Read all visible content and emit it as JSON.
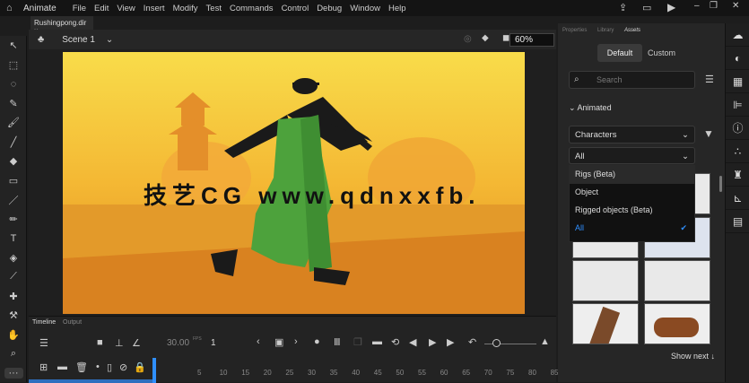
{
  "menubar": {
    "app": "Animate",
    "items": [
      "File",
      "Edit",
      "View",
      "Insert",
      "Modify",
      "Test",
      "Commands",
      "Control",
      "Debug",
      "Window",
      "Help"
    ]
  },
  "document": {
    "tab": "Rushingpong.dir",
    "scene": "Scene 1",
    "zoom": "60%"
  },
  "watermark": "技艺CG www.qdnxxfb.",
  "panel": {
    "tabs": [
      "Properties",
      "Library",
      "Assets"
    ],
    "active_tab": "Assets",
    "toggle": [
      "Default",
      "Custom"
    ],
    "search_placeholder": "Search",
    "section": "Animated",
    "category": "Characters",
    "filter": "All",
    "dropdown": {
      "items": [
        "Rigs (Beta)",
        "Object",
        "Rigged objects (Beta)",
        "All"
      ],
      "selected": "All"
    },
    "show_next": "Show next ↓"
  },
  "timeline": {
    "tabs": [
      "Timeline",
      "Output"
    ],
    "fps": "30.00",
    "fps_unit": "FPS",
    "frame": "1",
    "ruler": [
      "5",
      "10",
      "15",
      "20",
      "25",
      "30",
      "35",
      "40",
      "45",
      "50",
      "55",
      "60",
      "65",
      "70",
      "75",
      "80",
      "85"
    ]
  },
  "colors": {
    "accent": "#2f8fff",
    "stage_top": "#f7d33a",
    "stage_bottom": "#e08a18"
  }
}
